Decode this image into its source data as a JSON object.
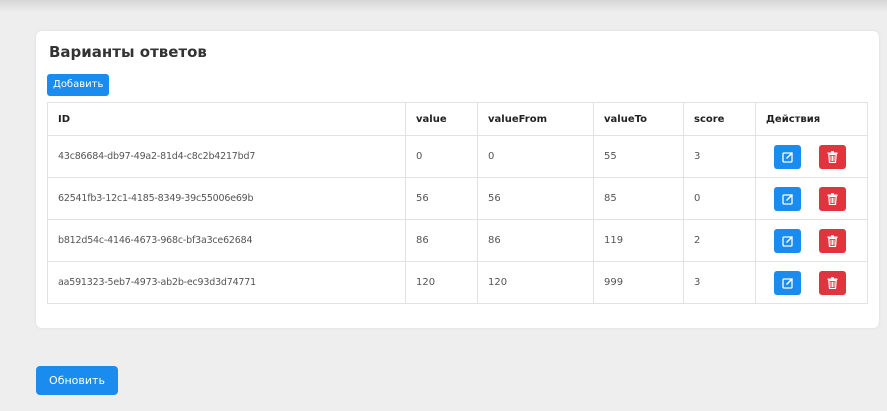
{
  "card": {
    "title": "Варианты ответов",
    "add_label": "Добавить"
  },
  "table": {
    "headers": [
      "ID",
      "value",
      "valueFrom",
      "valueTo",
      "score",
      "Действия"
    ],
    "rows": [
      {
        "id": "43c86684-db97-49a2-81d4-c8c2b4217bd7",
        "value": "0",
        "valueFrom": "0",
        "valueTo": "55",
        "score": "3"
      },
      {
        "id": "62541fb3-12c1-4185-8349-39c55006e69b",
        "value": "56",
        "valueFrom": "56",
        "valueTo": "85",
        "score": "0"
      },
      {
        "id": "b812d54c-4146-4673-968c-bf3a3ce62684",
        "value": "86",
        "valueFrom": "86",
        "valueTo": "119",
        "score": "2"
      },
      {
        "id": "aa591323-5eb7-4973-ab2b-ec93d3d74771",
        "value": "120",
        "valueFrom": "120",
        "valueTo": "999",
        "score": "3"
      }
    ],
    "row_actions": {
      "edit_icon": "edit-icon",
      "delete_icon": "trash-icon"
    }
  },
  "footer": {
    "refresh_label": "Обновить"
  },
  "colors": {
    "primary": "#1a8cf0",
    "danger": "#e0343e"
  }
}
